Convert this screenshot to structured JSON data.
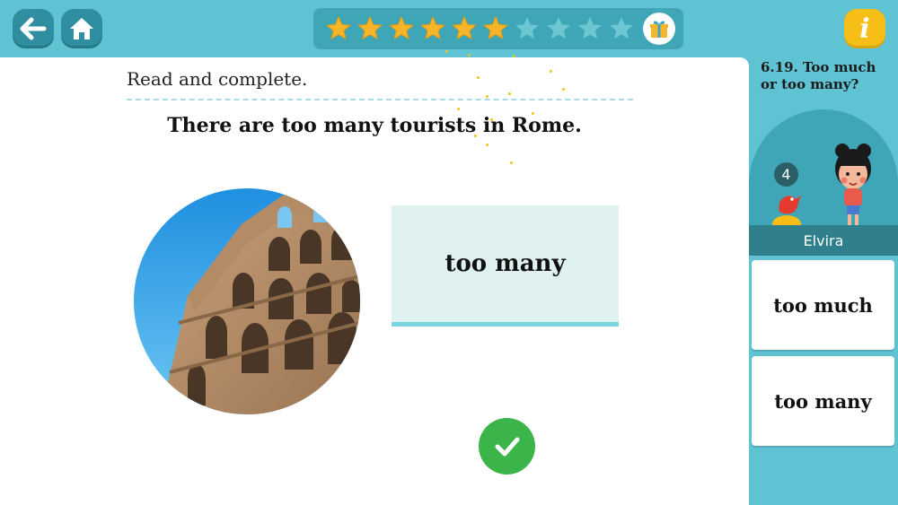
{
  "topbar": {
    "back_icon": "arrow-left-icon",
    "home_icon": "home-icon",
    "progress": {
      "filled": 6,
      "total": 10
    },
    "gift_icon": "gift-icon",
    "info_label": "i"
  },
  "main": {
    "instruction": "Read and complete.",
    "sentence": "There are too many tourists in Rome.",
    "answer": "too many",
    "image_subject": "Colosseum",
    "check_icon": "checkmark-icon"
  },
  "sidebar": {
    "title": "6.19. Too much or too many?",
    "level": "4",
    "character_name": "Elvira",
    "options": [
      {
        "label": "too much"
      },
      {
        "label": "too many"
      }
    ]
  },
  "colors": {
    "background": "#5fc3d3",
    "star_filled": "#f7b62a",
    "star_empty": "#6cc7d3",
    "answer_box": "#dff1f1",
    "check_button": "#3bb54a",
    "info_button": "#f7be17"
  }
}
